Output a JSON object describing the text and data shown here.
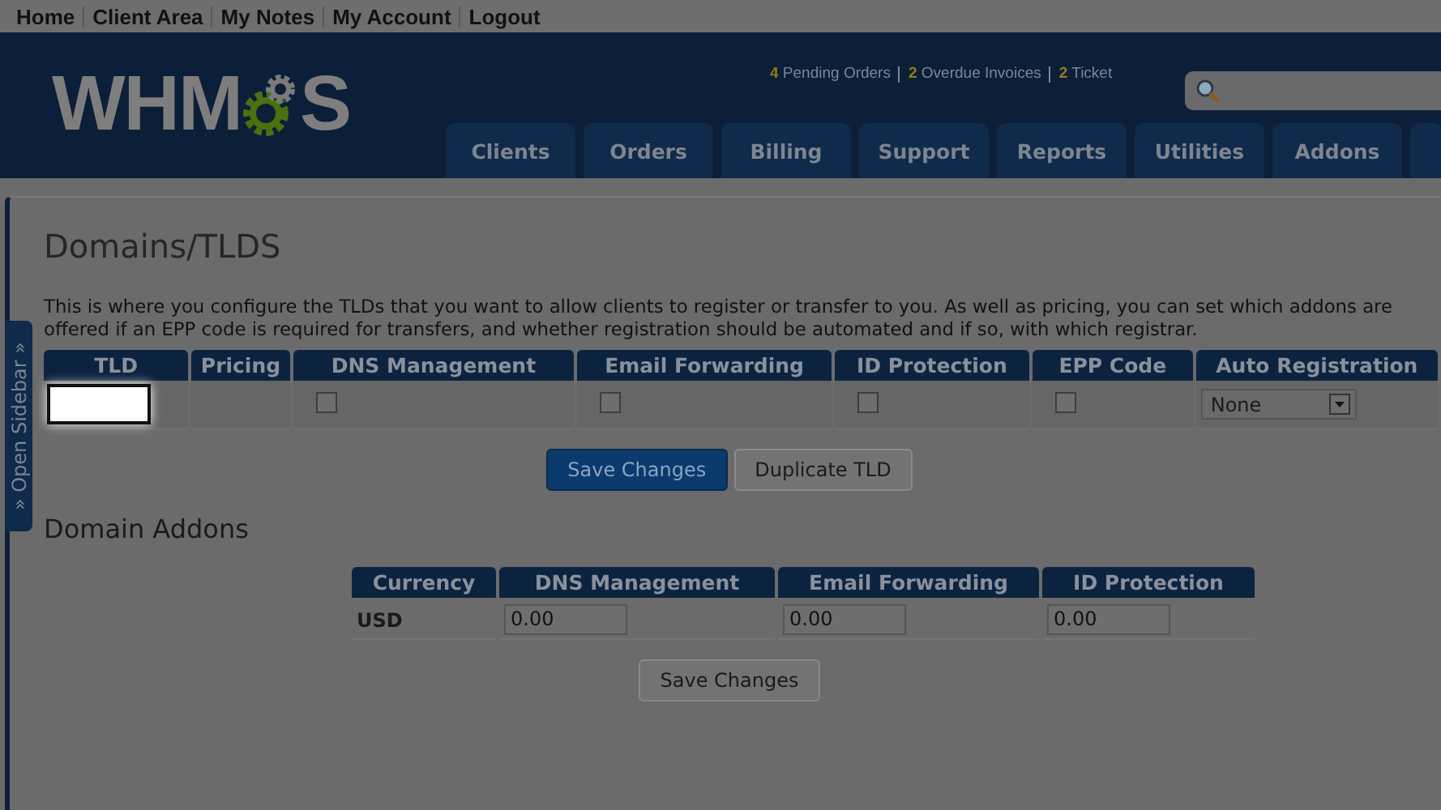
{
  "top_links": [
    "Home",
    "Client Area",
    "My Notes",
    "My Account",
    "Logout"
  ],
  "logo": {
    "left": "WHM",
    "right": "S"
  },
  "stats": [
    {
      "count": "4",
      "label": "Pending Orders"
    },
    {
      "count": "2",
      "label": "Overdue Invoices"
    },
    {
      "count": "2",
      "label": "Ticket"
    }
  ],
  "nav_tabs": [
    "Clients",
    "Orders",
    "Billing",
    "Support",
    "Reports",
    "Utilities",
    "Addons"
  ],
  "sidebar_toggle": "» Open Sidebar »",
  "page": {
    "title": "Domains/TLDS",
    "description": "This is where you configure the TLDs that you want to allow clients to register or transfer to you. As well as pricing, you can set which addons are offered if an EPP code is required for transfers, and whether registration should be automated and if so, with which registrar."
  },
  "tld_table": {
    "columns": [
      "TLD",
      "Pricing",
      "DNS Management",
      "Email Forwarding",
      "ID Protection",
      "EPP Code",
      "Auto Registration"
    ],
    "rows": [
      {
        "dns_management": false,
        "email_forwarding": false,
        "id_protection": false,
        "epp_code": false,
        "auto_registration": "None"
      }
    ]
  },
  "tld_buttons": [
    {
      "label": "Save Changes",
      "kind": "primary"
    },
    {
      "label": "Duplicate TLD",
      "kind": "secondary"
    }
  ],
  "addons": {
    "title": "Domain Addons",
    "columns": [
      "Currency",
      "DNS Management",
      "Email Forwarding",
      "ID Protection"
    ],
    "rows": [
      {
        "currency": "USD",
        "values": [
          "0.00",
          "0.00",
          "0.00"
        ]
      }
    ],
    "button": "Save Changes"
  }
}
